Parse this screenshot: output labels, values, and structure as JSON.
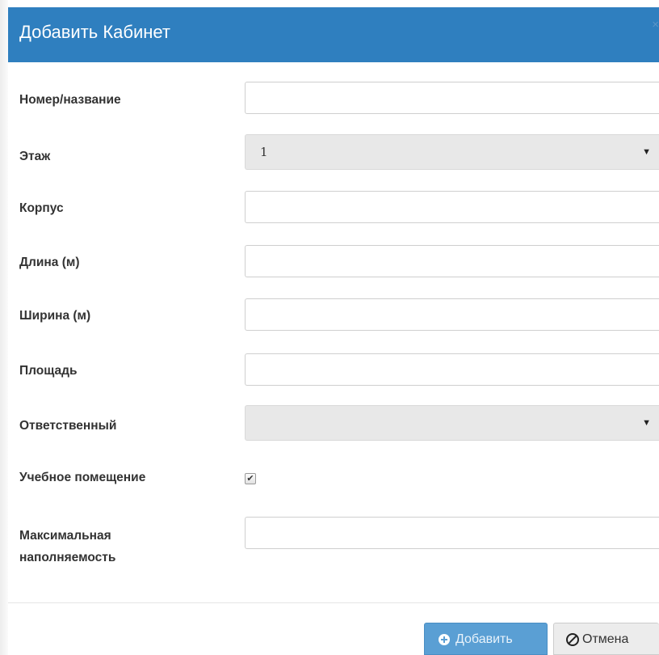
{
  "dialog": {
    "title": "Добавить Кабинет",
    "close_glyph": "×"
  },
  "form": {
    "name_label": "Номер/название",
    "name_value": "",
    "floor_label": "Этаж",
    "floor_selected": "1",
    "building_label": "Корпус",
    "building_value": "",
    "length_label": "Длина (м)",
    "length_value": "",
    "width_label": "Ширина (м)",
    "width_value": "",
    "area_label": "Площадь",
    "area_value": "",
    "responsible_label": "Ответственный",
    "responsible_selected": "",
    "educational_label": "Учебное помещение",
    "educational_checked": true,
    "max_capacity_label_line1": "Максимальная",
    "max_capacity_label_line2": "наполняемость",
    "max_capacity_value": ""
  },
  "footer": {
    "add_label": "Добавить",
    "cancel_label": "Отмена"
  },
  "icons": {
    "caret": "chevron-down-icon",
    "add": "plus-circle-icon",
    "cancel": "ban-icon",
    "check": "checkmark-icon"
  },
  "colors": {
    "header_bg": "#2f7fbf",
    "primary_button": "#5a9fd4",
    "select_bg": "#e8e8e8"
  }
}
